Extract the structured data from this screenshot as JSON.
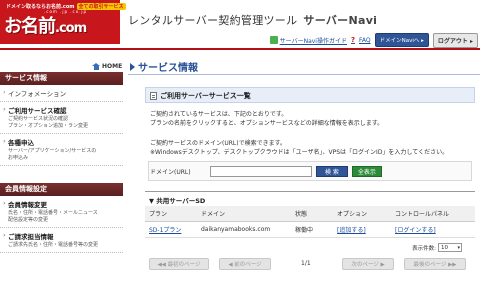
{
  "header": {
    "logo_tagline": "ドメイン取るならお名前.com",
    "logo_badge": "全ての取引サービス",
    "logo_domains": ".com .jp .co.jp",
    "logo_main": "お名前",
    "logo_com": ".com",
    "app_title": "レンタルサーバー契約管理ツール",
    "app_name": "サーバーNavi",
    "guide_link": "サーバーNavi操作ガイド",
    "faq_link": "FAQ",
    "domain_navi_button": "ドメインNaviへ ▸",
    "logout_button": "ログアウト ▸"
  },
  "nav": {
    "home": "HOME",
    "page_title": "サービス情報"
  },
  "sidebar": {
    "section1": "サービス情報",
    "items1": [
      {
        "label": "インフォメーション",
        "sub": ""
      },
      {
        "label": "ご利用サービス確認",
        "sub": "ご契約サービス状況の確認\nプラン・オプション追加・ラン変更"
      },
      {
        "label": "各種申込",
        "sub": "サーバー/アプリケーション/サービスの\nお申込み"
      }
    ],
    "section2": "会員情報設定",
    "items2": [
      {
        "label": "会員情報変更",
        "sub": "氏名・住所・電話番号・メールニュース\n配信設定等の変更"
      },
      {
        "label": "ご請求担当情報",
        "sub": "ご請求先氏名・住所・電話番号等の変更"
      }
    ]
  },
  "main": {
    "panel_title": "ご利用サーバーサービス一覧",
    "desc_lines": [
      "ご契約されているサービスは、下記のとおりです。",
      "プランの名前をクリックすると、オプションサービスなどの詳細な情報を表示します。",
      "",
      "ご契約サービスのドメイン(URL)で検索できます。",
      "※Windowsデスクトップ、デスクトップクラウドは「ユーザ名」、VPSは「ログインID」を入力してください。"
    ],
    "search_label": "ドメイン(URL)",
    "search_value": "",
    "search_button": "検 索",
    "show_all_button": "全表示",
    "section_title": "▼ 共用サーバーSD",
    "table": {
      "headers": [
        "プラン",
        "ドメイン",
        "状態",
        "オプション",
        "コントロールパネル"
      ],
      "rows": [
        [
          "SD-1プラン",
          "daikanyamabooks.com",
          "稼働中",
          "[追加する]",
          "[ログインする]"
        ]
      ]
    },
    "per_page_label": "表示件数:",
    "per_page_value": "10",
    "pager": {
      "first": "◀◀ 最初のページ",
      "prev": "◀ 前のページ",
      "count": "1/1",
      "next": "次のページ ▶",
      "last": "最後のページ ▶▶"
    }
  },
  "colors": {
    "brand_red": "#c8161d",
    "accent_blue": "#2a5298",
    "sidebar_head": "#6a2626"
  }
}
